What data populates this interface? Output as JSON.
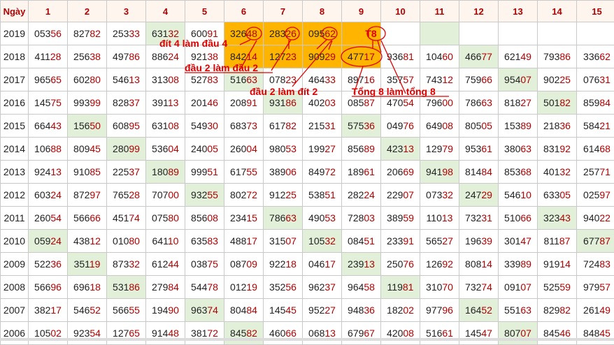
{
  "header": {
    "corner": "Ngày",
    "days": [
      "1",
      "2",
      "3",
      "4",
      "5",
      "6",
      "7",
      "8",
      "9",
      "10",
      "11",
      "12",
      "13",
      "14",
      "15"
    ]
  },
  "rows": [
    {
      "year": "2019",
      "cells": [
        [
          "053",
          "56"
        ],
        [
          "827",
          "82"
        ],
        [
          "253",
          "33"
        ],
        [
          "631",
          "32"
        ],
        [
          "600",
          "91"
        ],
        [
          "326",
          "48"
        ],
        [
          "283",
          "26"
        ],
        [
          "095",
          "62"
        ],
        [
          "",
          ""
        ],
        [
          "",
          ""
        ],
        [
          "",
          ""
        ],
        [
          "",
          ""
        ],
        [
          "",
          ""
        ],
        [
          "",
          ""
        ],
        [
          "",
          ""
        ]
      ]
    },
    {
      "year": "2018",
      "cells": [
        [
          "411",
          "28"
        ],
        [
          "256",
          "38"
        ],
        [
          "497",
          "86"
        ],
        [
          "886",
          "24"
        ],
        [
          "921",
          "38"
        ],
        [
          "842",
          "14"
        ],
        [
          "127",
          "23"
        ],
        [
          "909",
          "29"
        ],
        [
          "477",
          "17"
        ],
        [
          "936",
          "81"
        ],
        [
          "104",
          "60"
        ],
        [
          "466",
          "77"
        ],
        [
          "621",
          "49"
        ],
        [
          "793",
          "86"
        ],
        [
          "336",
          "62"
        ]
      ]
    },
    {
      "year": "2017",
      "cells": [
        [
          "965",
          "65"
        ],
        [
          "602",
          "80"
        ],
        [
          "546",
          "13"
        ],
        [
          "313",
          "08"
        ],
        [
          "527",
          "83"
        ],
        [
          "516",
          "63"
        ],
        [
          "078",
          "23"
        ],
        [
          "464",
          "33"
        ],
        [
          "897",
          "16"
        ],
        [
          "357",
          "57"
        ],
        [
          "743",
          "12"
        ],
        [
          "759",
          "66"
        ],
        [
          "954",
          "07"
        ],
        [
          "902",
          "25"
        ],
        [
          "076",
          "31"
        ]
      ]
    },
    {
      "year": "2016",
      "cells": [
        [
          "145",
          "75"
        ],
        [
          "993",
          "99"
        ],
        [
          "828",
          "37"
        ],
        [
          "391",
          "13"
        ],
        [
          "201",
          "46"
        ],
        [
          "208",
          "91"
        ],
        [
          "931",
          "86"
        ],
        [
          "402",
          "03"
        ],
        [
          "085",
          "87"
        ],
        [
          "470",
          "54"
        ],
        [
          "796",
          "00"
        ],
        [
          "786",
          "63"
        ],
        [
          "818",
          "27"
        ],
        [
          "501",
          "82"
        ],
        [
          "859",
          "84"
        ]
      ]
    },
    {
      "year": "2015",
      "cells": [
        [
          "664",
          "43"
        ],
        [
          "156",
          "50"
        ],
        [
          "608",
          "95"
        ],
        [
          "631",
          "08"
        ],
        [
          "549",
          "30"
        ],
        [
          "683",
          "73"
        ],
        [
          "617",
          "82"
        ],
        [
          "215",
          "31"
        ],
        [
          "575",
          "36"
        ],
        [
          "049",
          "76"
        ],
        [
          "649",
          "08"
        ],
        [
          "805",
          "05"
        ],
        [
          "153",
          "89"
        ],
        [
          "218",
          "36"
        ],
        [
          "584",
          "21"
        ]
      ]
    },
    {
      "year": "2014",
      "cells": [
        [
          "106",
          "88"
        ],
        [
          "809",
          "45"
        ],
        [
          "280",
          "99"
        ],
        [
          "536",
          "04"
        ],
        [
          "240",
          "05"
        ],
        [
          "260",
          "04"
        ],
        [
          "980",
          "53"
        ],
        [
          "199",
          "27"
        ],
        [
          "856",
          "89"
        ],
        [
          "423",
          "13"
        ],
        [
          "129",
          "79"
        ],
        [
          "953",
          "61"
        ],
        [
          "380",
          "63"
        ],
        [
          "831",
          "92"
        ],
        [
          "614",
          "68"
        ]
      ]
    },
    {
      "year": "2013",
      "cells": [
        [
          "924",
          "13"
        ],
        [
          "910",
          "85"
        ],
        [
          "225",
          "37"
        ],
        [
          "180",
          "89"
        ],
        [
          "999",
          "51"
        ],
        [
          "617",
          "55"
        ],
        [
          "389",
          "06"
        ],
        [
          "849",
          "72"
        ],
        [
          "189",
          "61"
        ],
        [
          "206",
          "69"
        ],
        [
          "941",
          "98"
        ],
        [
          "814",
          "84"
        ],
        [
          "853",
          "68"
        ],
        [
          "401",
          "32"
        ],
        [
          "257",
          "71"
        ]
      ]
    },
    {
      "year": "2012",
      "cells": [
        [
          "603",
          "24"
        ],
        [
          "872",
          "97"
        ],
        [
          "765",
          "28"
        ],
        [
          "707",
          "00"
        ],
        [
          "932",
          "55"
        ],
        [
          "802",
          "72"
        ],
        [
          "912",
          "25"
        ],
        [
          "538",
          "51"
        ],
        [
          "282",
          "24"
        ],
        [
          "229",
          "07"
        ],
        [
          "073",
          "32"
        ],
        [
          "247",
          "29"
        ],
        [
          "546",
          "10"
        ],
        [
          "633",
          "05"
        ],
        [
          "025",
          "97"
        ]
      ]
    },
    {
      "year": "2011",
      "cells": [
        [
          "260",
          "54"
        ],
        [
          "566",
          "66"
        ],
        [
          "451",
          "74"
        ],
        [
          "075",
          "80"
        ],
        [
          "856",
          "08"
        ],
        [
          "234",
          "15"
        ],
        [
          "786",
          "63"
        ],
        [
          "490",
          "53"
        ],
        [
          "728",
          "03"
        ],
        [
          "389",
          "59"
        ],
        [
          "110",
          "13"
        ],
        [
          "732",
          "31"
        ],
        [
          "510",
          "66"
        ],
        [
          "323",
          "43"
        ],
        [
          "940",
          "22"
        ]
      ]
    },
    {
      "year": "2010",
      "cells": [
        [
          "059",
          "24"
        ],
        [
          "438",
          "12"
        ],
        [
          "010",
          "80"
        ],
        [
          "641",
          "10"
        ],
        [
          "635",
          "83"
        ],
        [
          "488",
          "17"
        ],
        [
          "315",
          "07"
        ],
        [
          "105",
          "32"
        ],
        [
          "084",
          "51"
        ],
        [
          "233",
          "91"
        ],
        [
          "565",
          "27"
        ],
        [
          "196",
          "39"
        ],
        [
          "301",
          "47"
        ],
        [
          "811",
          "87"
        ],
        [
          "677",
          "87"
        ]
      ]
    },
    {
      "year": "2009",
      "cells": [
        [
          "522",
          "36"
        ],
        [
          "351",
          "19"
        ],
        [
          "873",
          "32"
        ],
        [
          "612",
          "44"
        ],
        [
          "038",
          "75"
        ],
        [
          "087",
          "09"
        ],
        [
          "922",
          "18"
        ],
        [
          "046",
          "17"
        ],
        [
          "239",
          "13"
        ],
        [
          "250",
          "76"
        ],
        [
          "126",
          "92"
        ],
        [
          "808",
          "14"
        ],
        [
          "339",
          "89"
        ],
        [
          "919",
          "14"
        ],
        [
          "724",
          "83"
        ]
      ]
    },
    {
      "year": "2008",
      "cells": [
        [
          "566",
          "96"
        ],
        [
          "696",
          "18"
        ],
        [
          "531",
          "86"
        ],
        [
          "279",
          "84"
        ],
        [
          "544",
          "78"
        ],
        [
          "012",
          "19"
        ],
        [
          "352",
          "56"
        ],
        [
          "962",
          "37"
        ],
        [
          "964",
          "58"
        ],
        [
          "119",
          "81"
        ],
        [
          "310",
          "70"
        ],
        [
          "732",
          "74"
        ],
        [
          "091",
          "07"
        ],
        [
          "525",
          "59"
        ],
        [
          "979",
          "57"
        ]
      ]
    },
    {
      "year": "2007",
      "cells": [
        [
          "382",
          "17"
        ],
        [
          "546",
          "52"
        ],
        [
          "566",
          "55"
        ],
        [
          "194",
          "90"
        ],
        [
          "963",
          "74"
        ],
        [
          "804",
          "84"
        ],
        [
          "145",
          "45"
        ],
        [
          "952",
          "27"
        ],
        [
          "948",
          "36"
        ],
        [
          "182",
          "02"
        ],
        [
          "977",
          "96"
        ],
        [
          "164",
          "52"
        ],
        [
          "551",
          "63"
        ],
        [
          "829",
          "82"
        ],
        [
          "261",
          "49"
        ]
      ]
    },
    {
      "year": "2006",
      "cells": [
        [
          "105",
          "02"
        ],
        [
          "923",
          "54"
        ],
        [
          "127",
          "65"
        ],
        [
          "914",
          "48"
        ],
        [
          "381",
          "72"
        ],
        [
          "845",
          "82"
        ],
        [
          "460",
          "66"
        ],
        [
          "068",
          "13"
        ],
        [
          "679",
          "67"
        ],
        [
          "420",
          "08"
        ],
        [
          "516",
          "61"
        ],
        [
          "145",
          "47"
        ],
        [
          "807",
          "07"
        ],
        [
          "845",
          "46"
        ],
        [
          "848",
          "45"
        ]
      ]
    }
  ],
  "annotations": {
    "tam": "T8",
    "dit4_dau4": "đít 4 làm đầu 4",
    "dau2_dau2": "đầu 2 làm đầu 2",
    "dau2_dit2": "đầu 2 làm đít 2",
    "tong8": "Tổng 8 làm tổng 8"
  },
  "colors": {
    "highlight_green": "#e2f0d9",
    "highlight_orange": "#ffb400",
    "annotation_red": "#e00000",
    "year_blue": "#1a3fb0",
    "tail_red": "#b30000"
  }
}
